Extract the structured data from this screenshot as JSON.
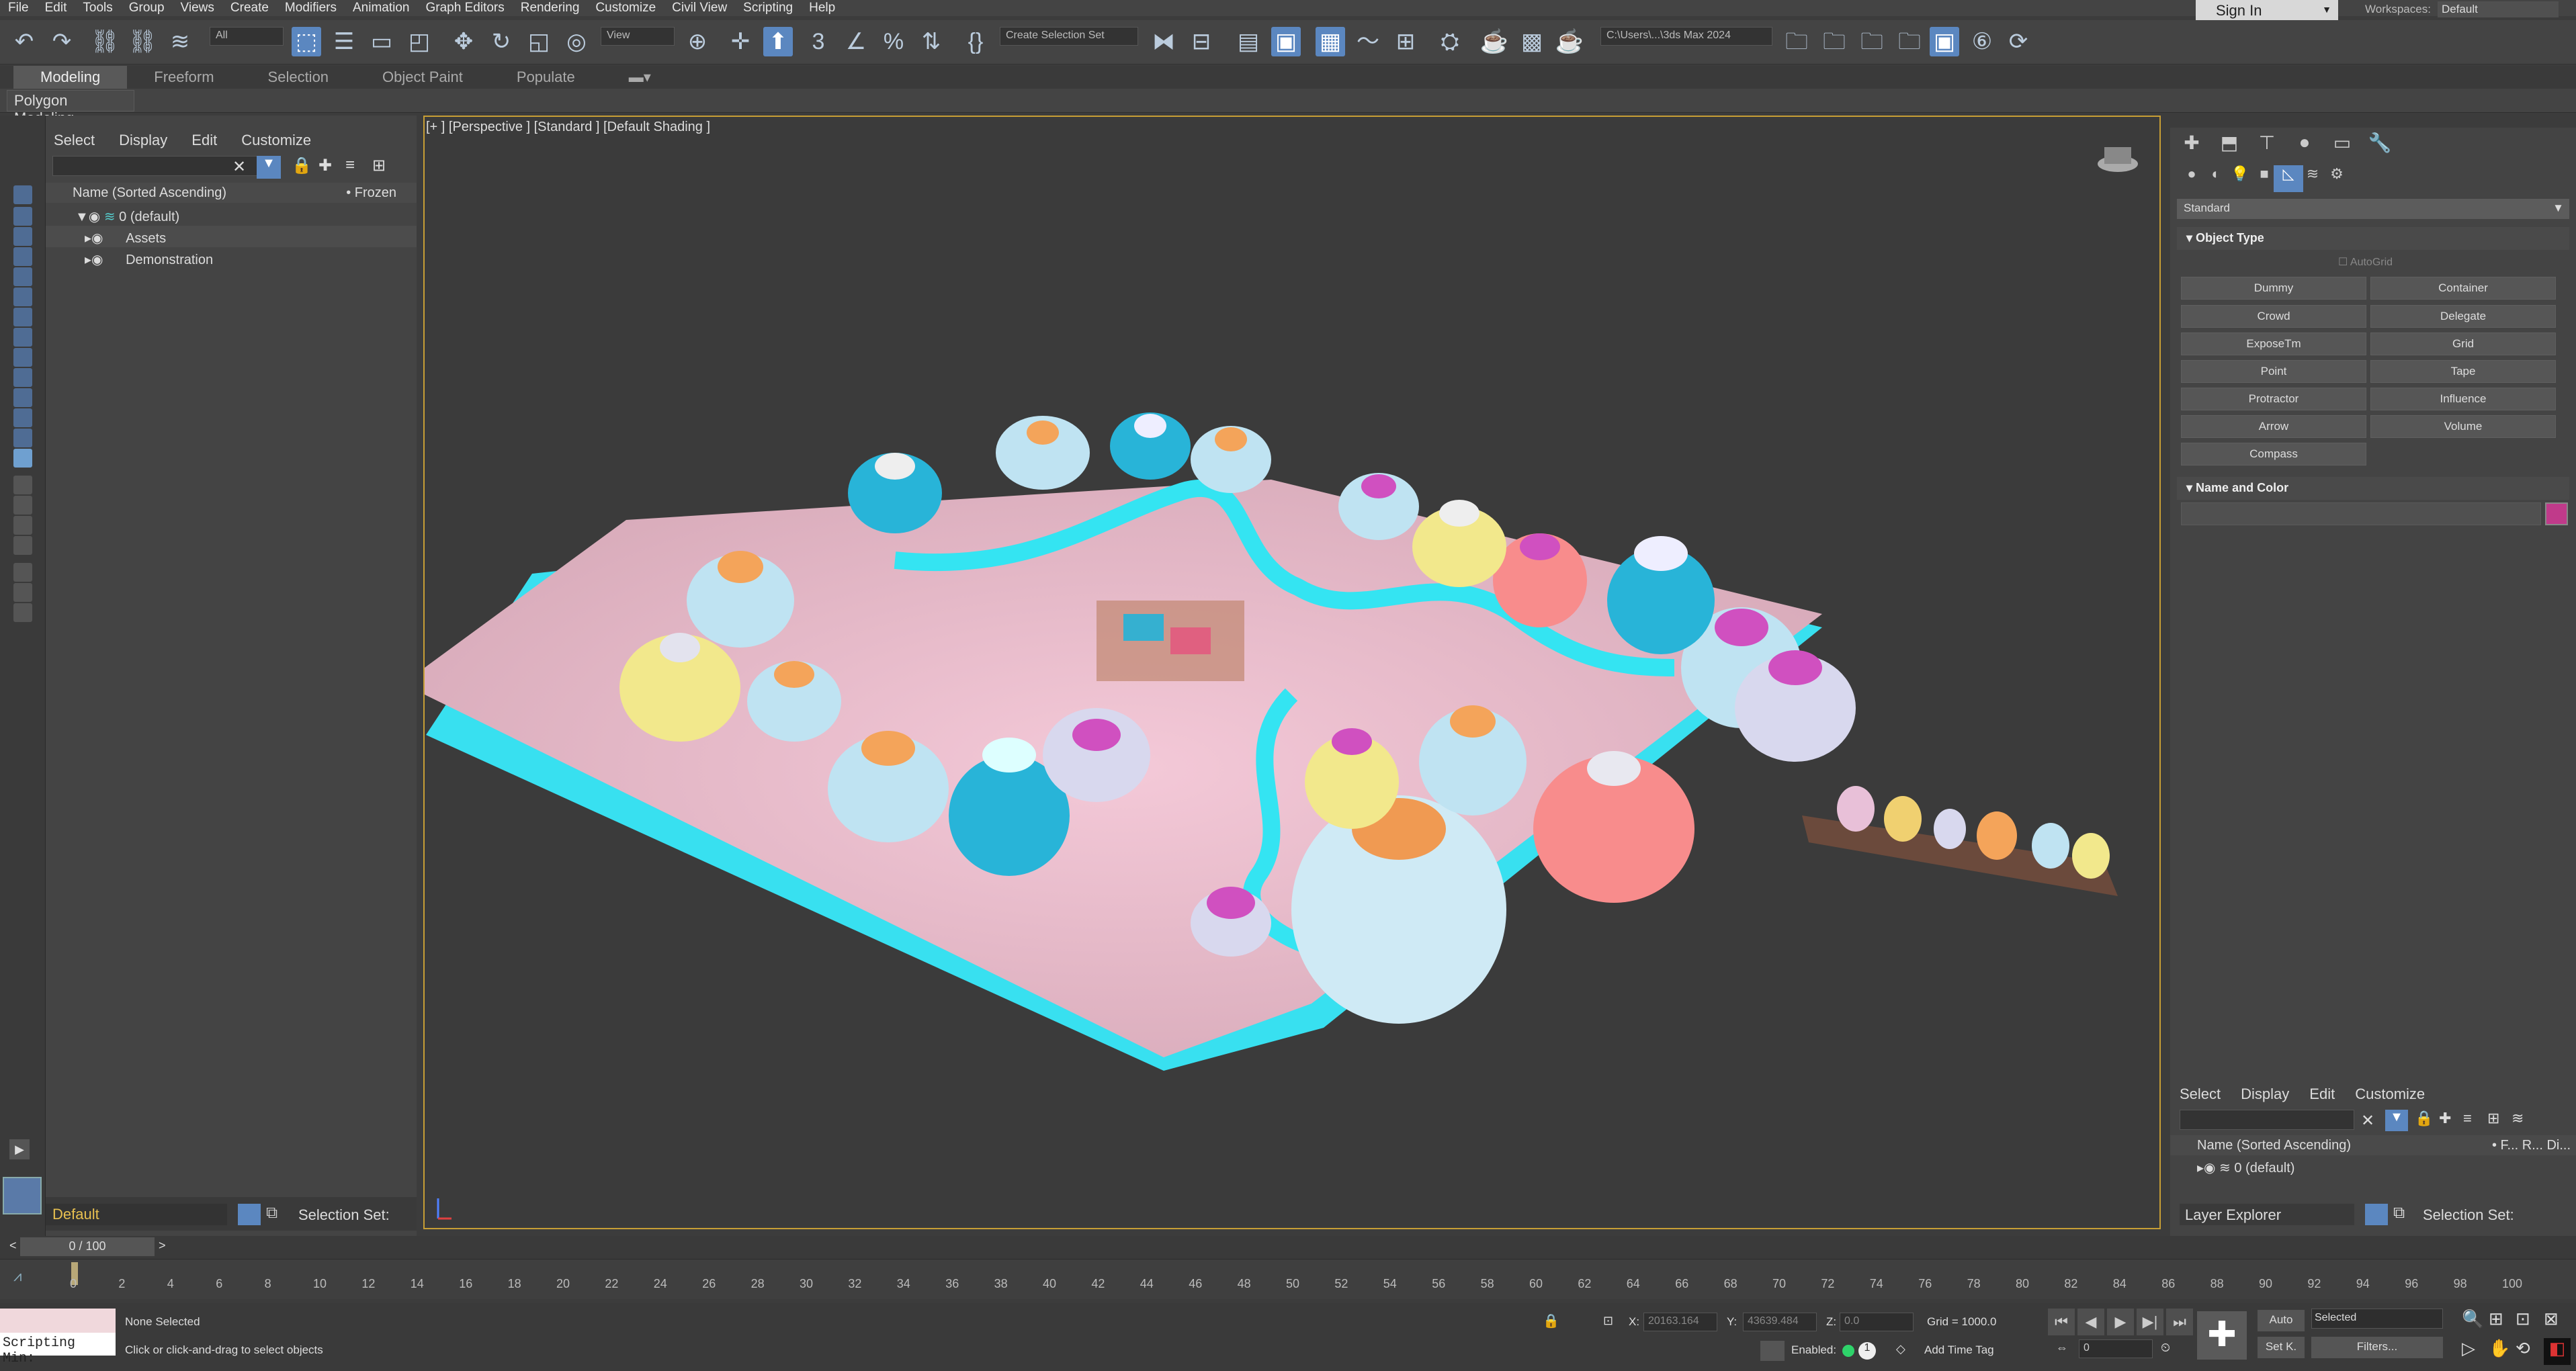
{
  "menu": [
    "File",
    "Edit",
    "Tools",
    "Group",
    "Views",
    "Create",
    "Modifiers",
    "Animation",
    "Graph Editors",
    "Rendering",
    "Customize",
    "Civil View",
    "Scripting",
    "Help"
  ],
  "account": {
    "sign_in": "Sign In",
    "workspaces_label": "Workspaces:",
    "workspace": "Default"
  },
  "toolbar": {
    "filter": "All",
    "view": "View",
    "selection_set": "Create Selection Set",
    "path": "C:\\Users\\...\\3ds Max 2024"
  },
  "ribbon": {
    "tabs": [
      "Modeling",
      "Freeform",
      "Selection",
      "Object Paint",
      "Populate"
    ],
    "sub": "Polygon Modeling"
  },
  "scene_explorer": {
    "menu": [
      "Select",
      "Display",
      "Edit",
      "Customize"
    ],
    "header": "Name (Sorted Ascending)",
    "frozen": "• Frozen",
    "rows": [
      "0 (default)",
      "Assets",
      "Demonstration"
    ],
    "layer": "Default",
    "selection_set": "Selection Set:"
  },
  "viewport": {
    "label": "[+ ]  [Perspective ]   [Standard ]   [Default Shading ]"
  },
  "command_panel": {
    "category": "Standard",
    "object_type": "Object Type",
    "autogrid": "AutoGrid",
    "buttons": [
      "Dummy",
      "Container",
      "Crowd",
      "Delegate",
      "ExposeTm",
      "Grid",
      "Point",
      "Tape",
      "Protractor",
      "Influence",
      "Arrow",
      "Volume",
      "Compass"
    ],
    "name_and_color": "Name and Color",
    "color": "#c03a8a"
  },
  "layer_explorer": {
    "menu": [
      "Select",
      "Display",
      "Edit",
      "Customize"
    ],
    "header": "Name (Sorted Ascending)",
    "cols": "• F...  R...  Di...",
    "row": "0 (default)",
    "title": "Layer Explorer",
    "selection_set": "Selection Set:"
  },
  "timeline": {
    "frame": "0 / 100",
    "ticks": [
      "0",
      "2",
      "4",
      "6",
      "8",
      "10",
      "12",
      "14",
      "16",
      "18",
      "20",
      "22",
      "24",
      "26",
      "28",
      "30",
      "32",
      "34",
      "36",
      "38",
      "40",
      "42",
      "44",
      "46",
      "48",
      "50",
      "52",
      "54",
      "56",
      "58",
      "60",
      "62",
      "64",
      "66",
      "68",
      "70",
      "72",
      "74",
      "76",
      "78",
      "80",
      "82",
      "84",
      "86",
      "88",
      "90",
      "92",
      "94",
      "96",
      "98",
      "100"
    ]
  },
  "status": {
    "script": "Scripting Min:",
    "none_selected": "None Selected",
    "prompt": "Click or click-and-drag to select objects",
    "x_label": "X:",
    "x": "20163.164",
    "y_label": "Y:",
    "y": "43639.484",
    "z_label": "Z:",
    "z": "0.0",
    "grid": "Grid = 1000.0",
    "enabled": "Enabled:",
    "add_time_tag": "Add Time Tag",
    "auto": "Auto",
    "selected": "Selected",
    "set_key": "Set K.",
    "filters": "Filters...",
    "frame": "0"
  }
}
